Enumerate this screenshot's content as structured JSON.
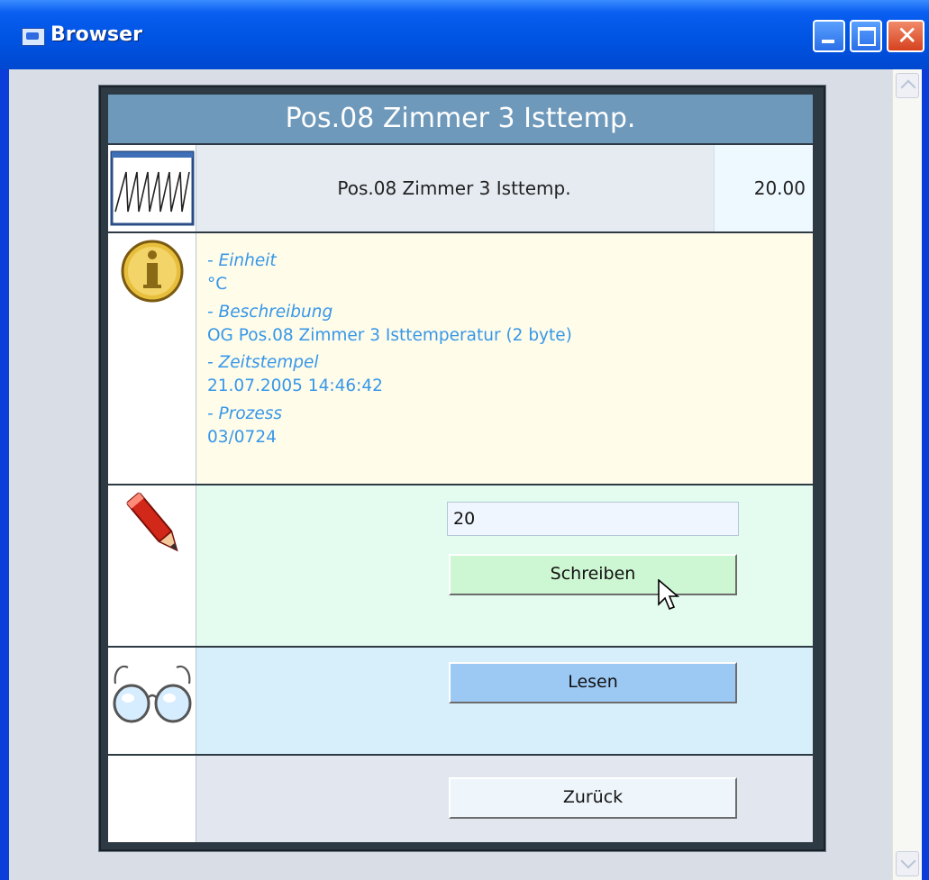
{
  "window": {
    "title": "Browser"
  },
  "panel": {
    "header": "Pos.08 Zimmer 3 Isttemp.",
    "item": {
      "name": "Pos.08 Zimmer 3 Isttemp.",
      "value": "20.00"
    },
    "info": [
      {
        "label": "- Einheit",
        "value": "°C"
      },
      {
        "label": "- Beschreibung",
        "value": "OG Pos.08 Zimmer 3 Isttemperatur (2 byte)"
      },
      {
        "label": "- Zeitstempel",
        "value": "21.07.2005 14:46:42"
      },
      {
        "label": "- Prozess",
        "value": "03/0724"
      }
    ],
    "write": {
      "input_value": "20",
      "button_label": "Schreiben"
    },
    "read": {
      "button_label": "Lesen"
    },
    "back": {
      "button_label": "Zurück"
    }
  },
  "icons": [
    "app-icon",
    "minimize-icon",
    "maximize-icon",
    "close-icon",
    "waveform-icon",
    "info-icon",
    "pencil-icon",
    "glasses-icon",
    "cursor-icon"
  ]
}
